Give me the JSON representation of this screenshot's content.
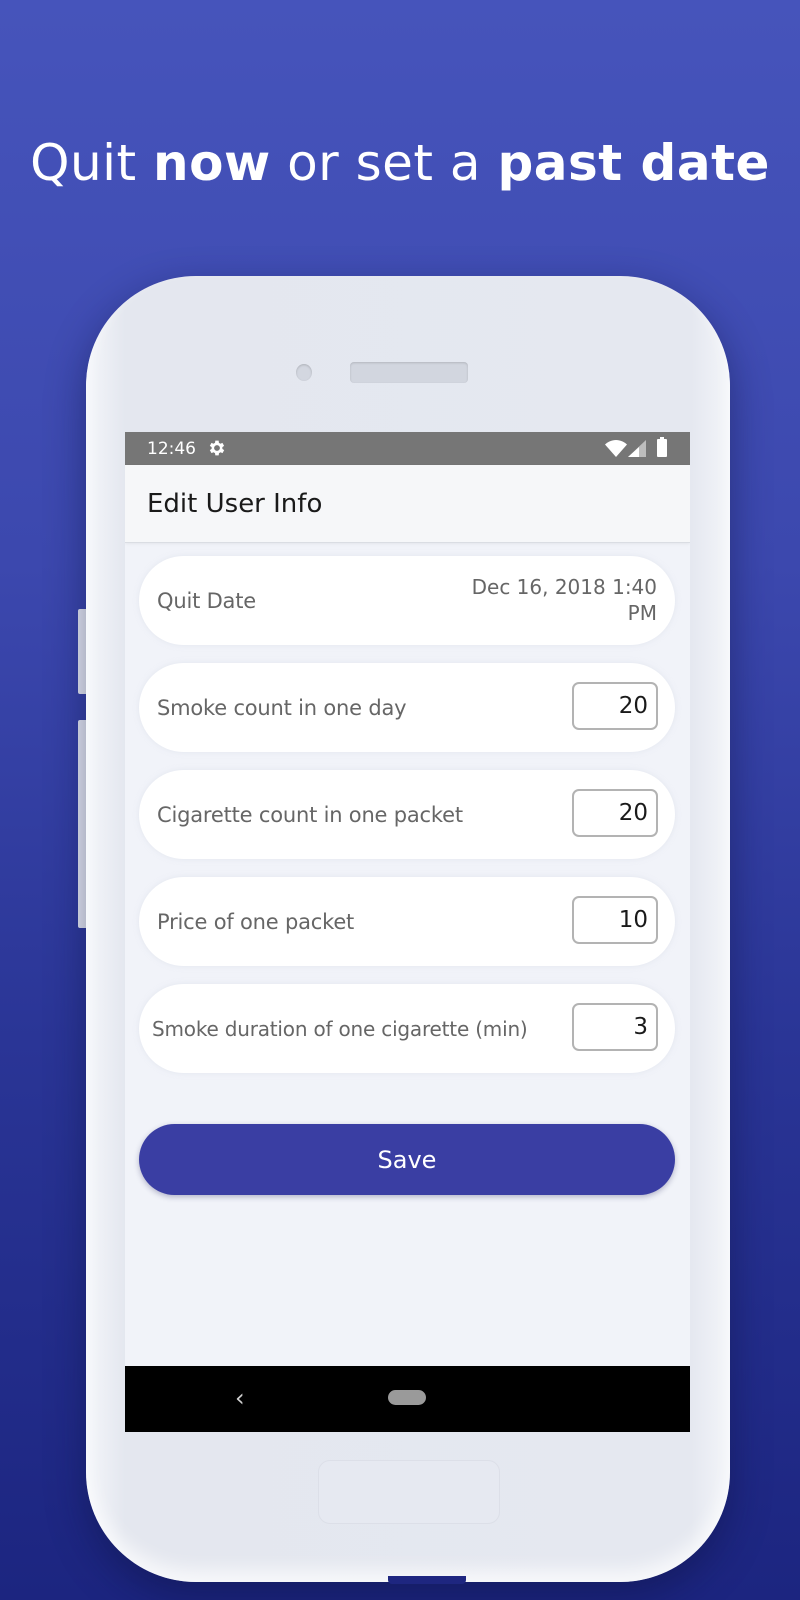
{
  "headline": {
    "part1": "Quit ",
    "part2_bold": "now",
    "part3": " or set a ",
    "part4_bold": "past date"
  },
  "statusbar": {
    "time": "12:46",
    "icons": [
      "gear-icon",
      "wifi-icon",
      "signal-icon",
      "battery-icon"
    ]
  },
  "appbar": {
    "title": "Edit User Info"
  },
  "form": {
    "quit_date": {
      "label": "Quit Date",
      "value_line1": "Dec 16, 2018 1:40",
      "value_line2": "PM"
    },
    "fields": [
      {
        "label": "Smoke count in one day",
        "value": "20"
      },
      {
        "label": "Cigarette count in one packet",
        "value": "20"
      },
      {
        "label": "Price of one packet",
        "value": "10"
      },
      {
        "label": "Smoke duration of one cigarette (min)",
        "value": "3"
      }
    ],
    "save_label": "Save"
  },
  "navbar": {
    "back_glyph": "‹",
    "icons": [
      "back-icon",
      "home-pill-icon"
    ]
  },
  "colors": {
    "background_top": "#4654bb",
    "background_bottom": "#1c2580",
    "accent": "#3a3ea3",
    "statusbar": "#767676"
  }
}
